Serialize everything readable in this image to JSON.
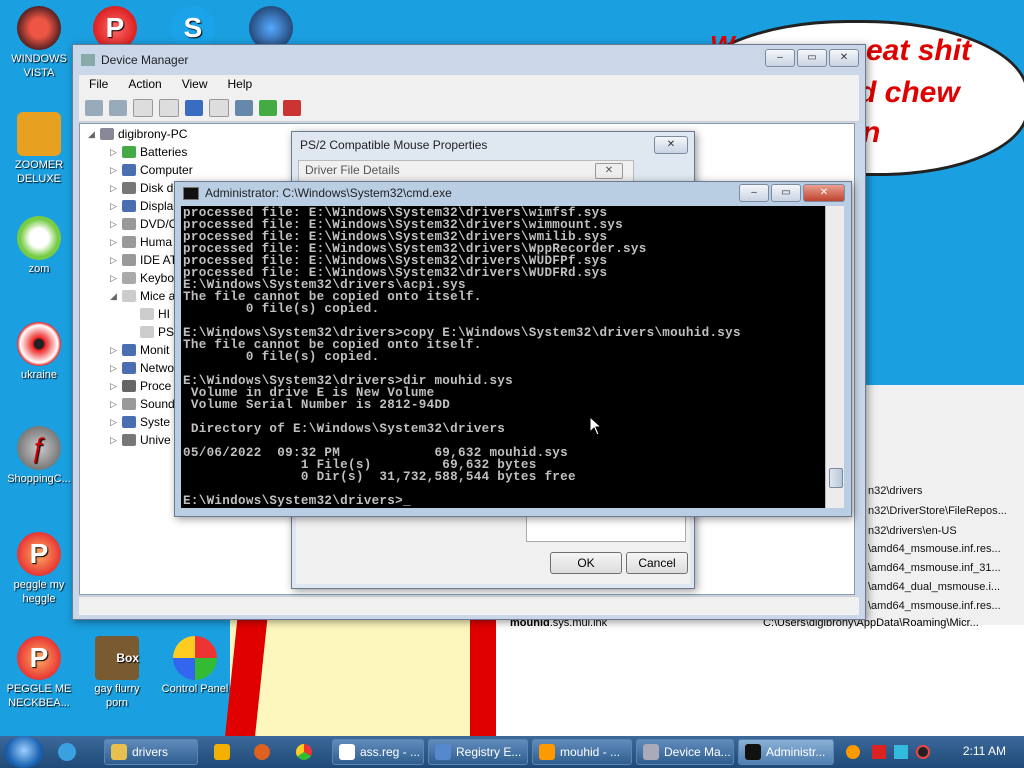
{
  "desktop": {
    "icons": [
      {
        "label": "WINDOWS VISTA"
      },
      {
        "label": "P"
      },
      {
        "label": "S"
      },
      {
        "label": "ZOOMER DELUXE"
      },
      {
        "label": "zom"
      },
      {
        "label": "ukraine"
      },
      {
        "label": "ShoppingC..."
      },
      {
        "label": "peggle my heggle"
      },
      {
        "label": "PEGGLE ME NECKBEA..."
      },
      {
        "label": "gay flurry porn"
      },
      {
        "label": "Box"
      },
      {
        "label": "Control Panel"
      }
    ],
    "wallpaper_text": [
      "eat shit",
      "d chew",
      "n"
    ]
  },
  "device_manager": {
    "title": "Device Manager",
    "menu": [
      "File",
      "Action",
      "View",
      "Help"
    ],
    "tree": {
      "root": "digibrony-PC",
      "items": [
        "Batteries",
        "Computer",
        "Disk d",
        "Displa",
        "DVD/C",
        "Huma",
        "IDE AT",
        "Keybo",
        "Mice a",
        "HI",
        "PS",
        "Monit",
        "Netwo",
        "Proce",
        "Sound",
        "Syste",
        "Unive"
      ]
    }
  },
  "mouse_props": {
    "title": "PS/2 Compatible Mouse Properties",
    "sub_title": "Driver File Details",
    "ok": "OK",
    "cancel": "Cancel"
  },
  "explorer_behind": {
    "rows": [
      "n32\\drivers",
      "n32\\DriverStore\\FileRepos...",
      "n32\\drivers\\en-US",
      "\\amd64_msmouse.inf.res...",
      "\\amd64_msmouse.inf_31...",
      "\\amd64_dual_msmouse.i...",
      "\\amd64_msmouse.inf.res..."
    ],
    "file_name": "mouhid",
    "file_suffix": ".sys.mui.lnk",
    "file_path": "C:\\Users\\digibrony\\AppData\\Roaming\\Micr..."
  },
  "cmd": {
    "title": "Administrator: C:\\Windows\\System32\\cmd.exe",
    "lines": [
      "processed file: E:\\Windows\\System32\\drivers\\wimfsf.sys",
      "processed file: E:\\Windows\\System32\\drivers\\wimmount.sys",
      "processed file: E:\\Windows\\System32\\drivers\\wmilib.sys",
      "processed file: E:\\Windows\\System32\\drivers\\WppRecorder.sys",
      "processed file: E:\\Windows\\System32\\drivers\\WUDFPf.sys",
      "processed file: E:\\Windows\\System32\\drivers\\WUDFRd.sys",
      "E:\\Windows\\System32\\drivers\\acpi.sys",
      "The file cannot be copied onto itself.",
      "        0 file(s) copied.",
      "",
      "E:\\Windows\\System32\\drivers>copy E:\\Windows\\System32\\drivers\\mouhid.sys",
      "The file cannot be copied onto itself.",
      "        0 file(s) copied.",
      "",
      "E:\\Windows\\System32\\drivers>dir mouhid.sys",
      " Volume in drive E is New Volume",
      " Volume Serial Number is 2812-94DD",
      "",
      " Directory of E:\\Windows\\System32\\drivers",
      "",
      "05/06/2022  09:32 PM            69,632 mouhid.sys",
      "               1 File(s)         69,632 bytes",
      "               0 Dir(s)  31,732,588,544 bytes free",
      "",
      "E:\\Windows\\System32\\drivers>_"
    ]
  },
  "taskbar": {
    "tasks": [
      "drivers",
      "ass.reg - ...",
      "Registry E...",
      "mouhid - ...",
      "Device Ma...",
      "Administr..."
    ],
    "clock": "2:11 AM"
  }
}
